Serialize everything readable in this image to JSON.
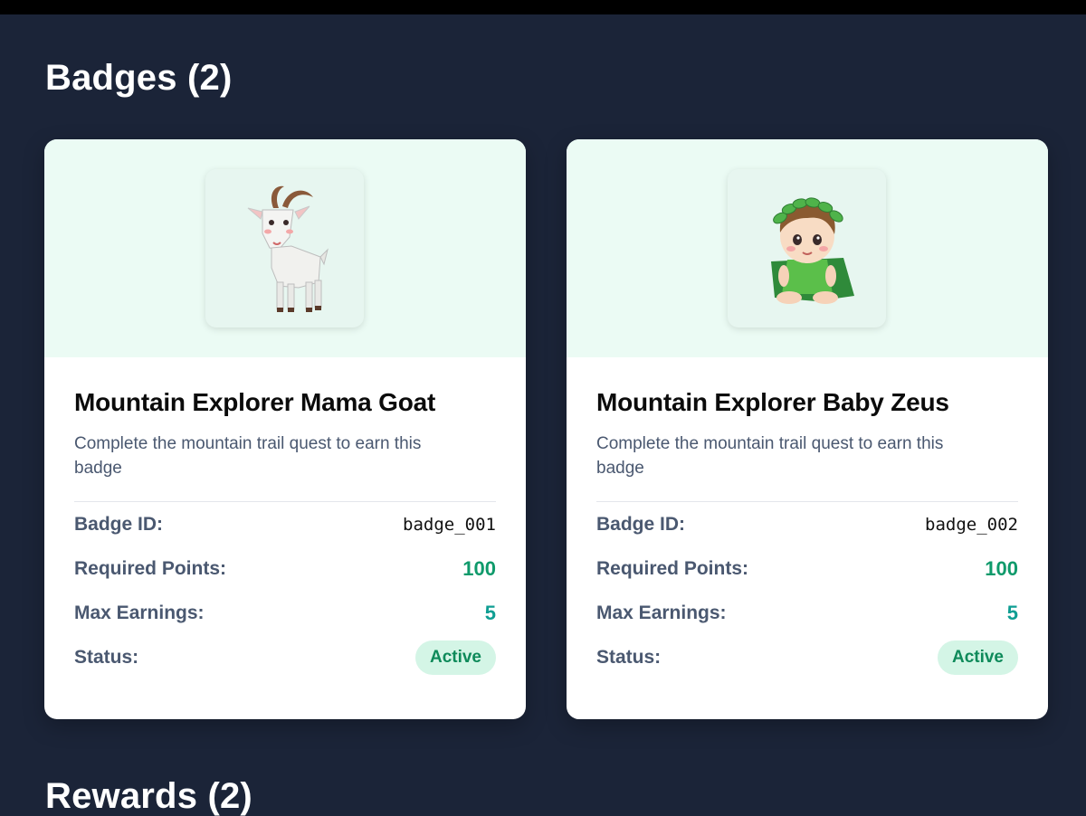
{
  "badges_section": {
    "title": "Badges (2)"
  },
  "rewards_section": {
    "title": "Rewards (2)"
  },
  "labels": {
    "badge_id": "Badge ID:",
    "required_points": "Required Points:",
    "max_earnings": "Max Earnings:",
    "status": "Status:"
  },
  "colors": {
    "page_background": "#1b2438",
    "card_hero_background": "#ebfbf4",
    "points_value": "#0f9a6b",
    "earnings_value": "#0f9e93",
    "status_pill": "#d4f5e6"
  },
  "badges": [
    {
      "image_icon": "goat-icon",
      "title": "Mountain Explorer Mama Goat",
      "description": "Complete the mountain trail quest to earn this badge",
      "badge_id": "badge_001",
      "required_points": "100",
      "max_earnings": "5",
      "status": "Active"
    },
    {
      "image_icon": "baby-zeus-icon",
      "title": "Mountain Explorer Baby Zeus",
      "description": "Complete the mountain trail quest to earn this badge",
      "badge_id": "badge_002",
      "required_points": "100",
      "max_earnings": "5",
      "status": "Active"
    }
  ]
}
